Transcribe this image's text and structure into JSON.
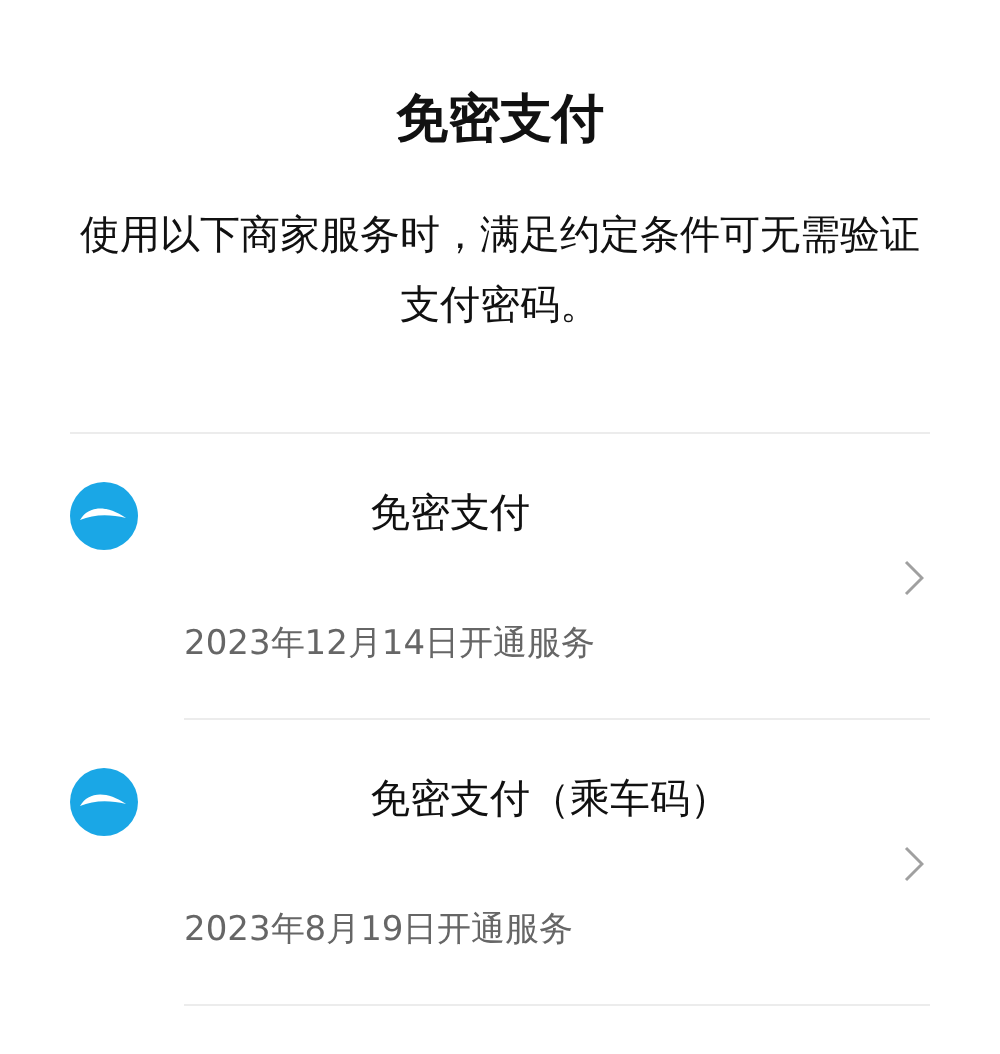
{
  "title": "免密支付",
  "description": "使用以下商家服务时，满足约定条件可无需验证支付密码。",
  "services": [
    {
      "name": "免密支付",
      "date": "2023年12月14日开通服务"
    },
    {
      "name": "免密支付（乘车码）",
      "date": "2023年8月19日开通服务"
    }
  ]
}
